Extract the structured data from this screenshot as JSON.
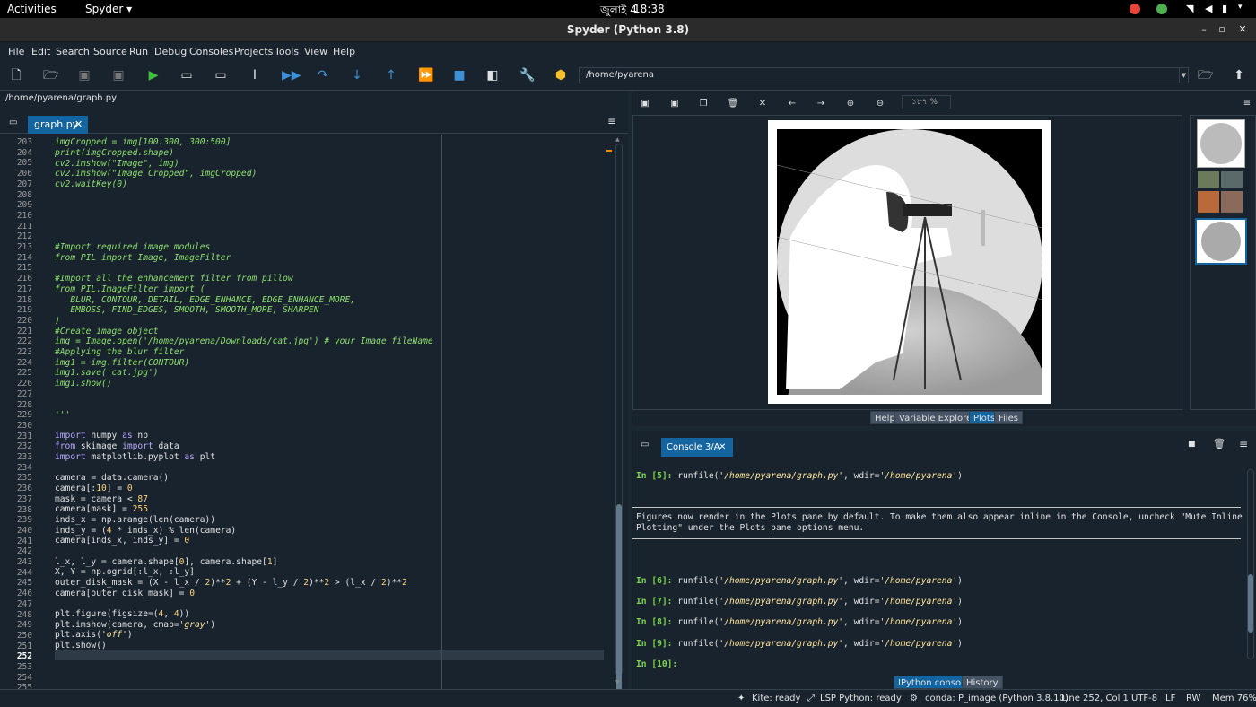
{
  "topbar": {
    "activities": "Activities",
    "app": "Spyder",
    "date": "জুলাই 4",
    "time": "18:38"
  },
  "window": {
    "title": "Spyder (Python 3.8)"
  },
  "menu": [
    "File",
    "Edit",
    "Search",
    "Source",
    "Run",
    "Debug",
    "Consoles",
    "Projects",
    "Tools",
    "View",
    "Help"
  ],
  "toolbar": {
    "path": "/home/pyarena"
  },
  "editor": {
    "file_path": "/home/pyarena/graph.py",
    "tab_label": "graph.py",
    "line_numbers": [
      "203",
      "204",
      "205",
      "206",
      "207",
      "208",
      "209",
      "210",
      "211",
      "212",
      "213",
      "214",
      "215",
      "216",
      "217",
      "218",
      "219",
      "220",
      "221",
      "222",
      "223",
      "224",
      "225",
      "226",
      "227",
      "228",
      "229",
      "230",
      "231",
      "232",
      "233",
      "234",
      "235",
      "236",
      "237",
      "238",
      "239",
      "240",
      "241",
      "242",
      "243",
      "244",
      "245",
      "246",
      "247",
      "248",
      "249",
      "250",
      "251",
      "252",
      "253",
      "254",
      "255"
    ],
    "current_line": "252"
  },
  "plots": {
    "zoom": "১৮৭ %",
    "tabs": [
      "Help",
      "Variable Explorer",
      "Plots",
      "Files"
    ]
  },
  "console": {
    "tab_label": "Console 3/A",
    "lines": [
      {
        "prompt": "In [5]:",
        "cmd": " runfile(",
        "arg1": "'/home/pyarena/graph.py'",
        "mid": ", wdir=",
        "arg2": "'/home/pyarena'",
        "end": ")"
      },
      {
        "prompt": "In [6]:",
        "cmd": " runfile(",
        "arg1": "'/home/pyarena/graph.py'",
        "mid": ", wdir=",
        "arg2": "'/home/pyarena'",
        "end": ")"
      },
      {
        "prompt": "In [7]:",
        "cmd": " runfile(",
        "arg1": "'/home/pyarena/graph.py'",
        "mid": ", wdir=",
        "arg2": "'/home/pyarena'",
        "end": ")"
      },
      {
        "prompt": "In [8]:",
        "cmd": " runfile(",
        "arg1": "'/home/pyarena/graph.py'",
        "mid": ", wdir=",
        "arg2": "'/home/pyarena'",
        "end": ")"
      },
      {
        "prompt": "In [9]:",
        "cmd": " runfile(",
        "arg1": "'/home/pyarena/graph.py'",
        "mid": ", wdir=",
        "arg2": "'/home/pyarena'",
        "end": ")"
      }
    ],
    "notice1": "Figures now render in the Plots pane by default. To make them also appear inline in the Console, uncheck \"Mute Inline",
    "notice2": "Plotting\" under the Plots pane options menu.",
    "last_prompt": "In [10]:",
    "bottom_tabs": [
      "IPython console",
      "History"
    ]
  },
  "status": {
    "kite": "Kite: ready",
    "lsp": "LSP Python: ready",
    "conda": "conda: P_image (Python 3.8.10)",
    "position": "Line 252, Col 1",
    "encoding": "UTF-8",
    "eol": "LF",
    "perm": "RW",
    "mem": "Mem 76%"
  }
}
